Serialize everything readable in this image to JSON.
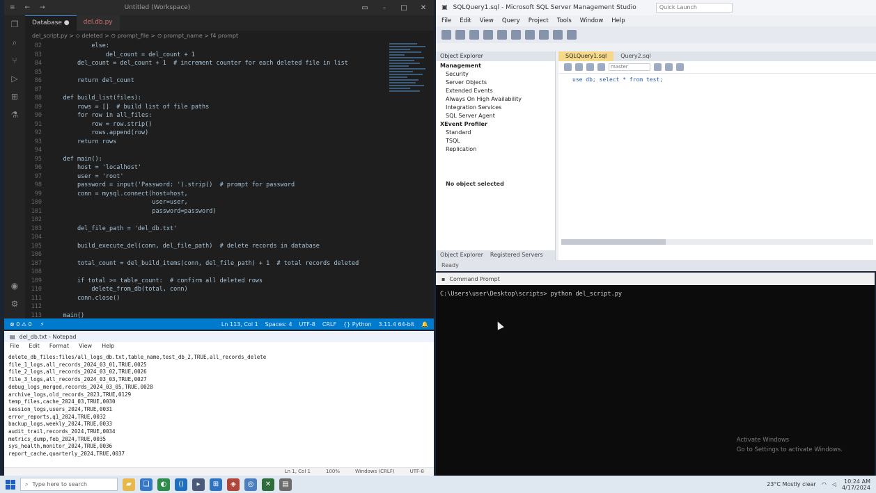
{
  "vscode": {
    "window_title": "Untitled (Workspace)",
    "tabs": [
      "Database ●",
      "del.db.py"
    ],
    "breadcrumb": "del_script.py > ◇ deleted > ⊙ prompt_file > ⊙ prompt_name > f4 prompt",
    "code_lines": [
      {
        "n": "82",
        "text": "            else:"
      },
      {
        "n": "83",
        "text": "                del_count = del_count + 1"
      },
      {
        "n": "84",
        "text": "        del_count = del_count + 1  # increment counter for each deleted file in list"
      },
      {
        "n": "85",
        "text": ""
      },
      {
        "n": "86",
        "text": "        return del_count"
      },
      {
        "n": "87",
        "text": ""
      },
      {
        "n": "88",
        "text": "    def build_list(files):"
      },
      {
        "n": "89",
        "text": "        rows = []  # build list of file paths"
      },
      {
        "n": "90",
        "text": "        for row in all_files:"
      },
      {
        "n": "91",
        "text": "            row = row.strip()"
      },
      {
        "n": "92",
        "text": "            rows.append(row)"
      },
      {
        "n": "93",
        "text": "        return rows"
      },
      {
        "n": "94",
        "text": ""
      },
      {
        "n": "95",
        "text": "    def main():"
      },
      {
        "n": "96",
        "text": "        host = 'localhost'"
      },
      {
        "n": "97",
        "text": "        user = 'root'"
      },
      {
        "n": "98",
        "text": "        password = input('Password: ').strip()  # prompt for password"
      },
      {
        "n": "99",
        "text": "        conn = mysql.connect(host=host,"
      },
      {
        "n": "100",
        "text": "                             user=user,"
      },
      {
        "n": "101",
        "text": "                             password=password)"
      },
      {
        "n": "102",
        "text": ""
      },
      {
        "n": "103",
        "text": "        del_file_path = 'del_db.txt'"
      },
      {
        "n": "104",
        "text": ""
      },
      {
        "n": "105",
        "text": "        build_execute_del(conn, del_file_path)  # delete records in database"
      },
      {
        "n": "106",
        "text": ""
      },
      {
        "n": "107",
        "text": "        total_count = del_build_items(conn, del_file_path) + 1  # total records deleted"
      },
      {
        "n": "108",
        "text": ""
      },
      {
        "n": "109",
        "text": "        if total >= table_count:  # confirm all deleted rows"
      },
      {
        "n": "110",
        "text": "            delete_from_db(total, conn)"
      },
      {
        "n": "111",
        "text": "        conn.close()"
      },
      {
        "n": "112",
        "text": ""
      },
      {
        "n": "113",
        "text": "    main()"
      }
    ],
    "status_left": [
      "⊗ 0 ⚠ 0",
      "⚡"
    ],
    "status_right": [
      "Ln 113, Col 1",
      "Spaces: 4",
      "UTF-8",
      "CRLF",
      "{} Python",
      "3.11.4 64-bit",
      "🔔"
    ]
  },
  "ssms": {
    "window_title": "SQLQuery1.sql - Microsoft SQL Server Management Studio",
    "quick_launch": "Quick Launch",
    "menu": [
      "File",
      "Edit",
      "View",
      "Query",
      "Project",
      "Tools",
      "Window",
      "Help"
    ],
    "object_explorer_title": "Object Explorer",
    "tree": [
      {
        "label": "Management",
        "cat": true
      },
      {
        "label": "Security",
        "cat": false
      },
      {
        "label": "Server Objects",
        "cat": false
      },
      {
        "label": "Extended Events",
        "cat": false
      },
      {
        "label": "Always On High Availability",
        "cat": false
      },
      {
        "label": "Integration Services",
        "cat": false
      },
      {
        "label": "SQL Server Agent",
        "cat": false
      },
      {
        "label": "XEvent Profiler",
        "cat": true
      },
      {
        "label": "Standard",
        "cat": false
      },
      {
        "label": "TSQL",
        "cat": false
      },
      {
        "label": "Replication",
        "cat": false
      }
    ],
    "explorer_tabs": [
      "Object Explorer",
      "Registered Servers"
    ],
    "explorer_footer": "No object selected",
    "query_tabs": [
      "SQLQuery1.sql",
      "Query2.sql"
    ],
    "db_dropdown": "master",
    "query_text": "use db; select * from test;",
    "status": "Ready"
  },
  "console": {
    "title": "Command Prompt",
    "prompt_line": "C:\\Users\\user\\Desktop\\scripts> python del_script.py",
    "activate_line1": "Activate Windows",
    "activate_line2": "Go to Settings to activate Windows."
  },
  "notepad": {
    "title": "del_db.txt - Notepad",
    "menu": [
      "File",
      "Edit",
      "Format",
      "View",
      "Help"
    ],
    "lines": [
      "delete_db_files:files/all_logs_db.txt,table_name,test_db_2,TRUE,all_records_delete",
      "file_1_logs,all_records_2024_03_01,TRUE,0025",
      "file_2_logs,all_records_2024_03_02,TRUE,0026",
      "file_3_logs,all_records_2024_03_03,TRUE,0027",
      "debug_logs_merged,records_2024_03_05,TRUE,0028",
      "archive_logs,old_records_2023,TRUE,0129",
      "temp_files,cache_2024_03,TRUE,0030",
      "session_logs,users_2024,TRUE,0031",
      "error_reports,q1_2024,TRUE,0032",
      "backup_logs,weekly_2024,TRUE,0033",
      "audit_trail,records_2024,TRUE,0034",
      "metrics_dump,feb_2024,TRUE,0035",
      "sys_health,monitor_2024,TRUE,0036",
      "report_cache,quarterly_2024,TRUE,0037"
    ],
    "status": [
      "Ln 1, Col 1",
      "100%",
      "Windows (CRLF)",
      "UTF-8"
    ]
  },
  "taskbar": {
    "search_placeholder": "Type here to search",
    "tray_weather": "23°C Mostly clear",
    "time": "10:24 AM",
    "date": "4/17/2024"
  }
}
